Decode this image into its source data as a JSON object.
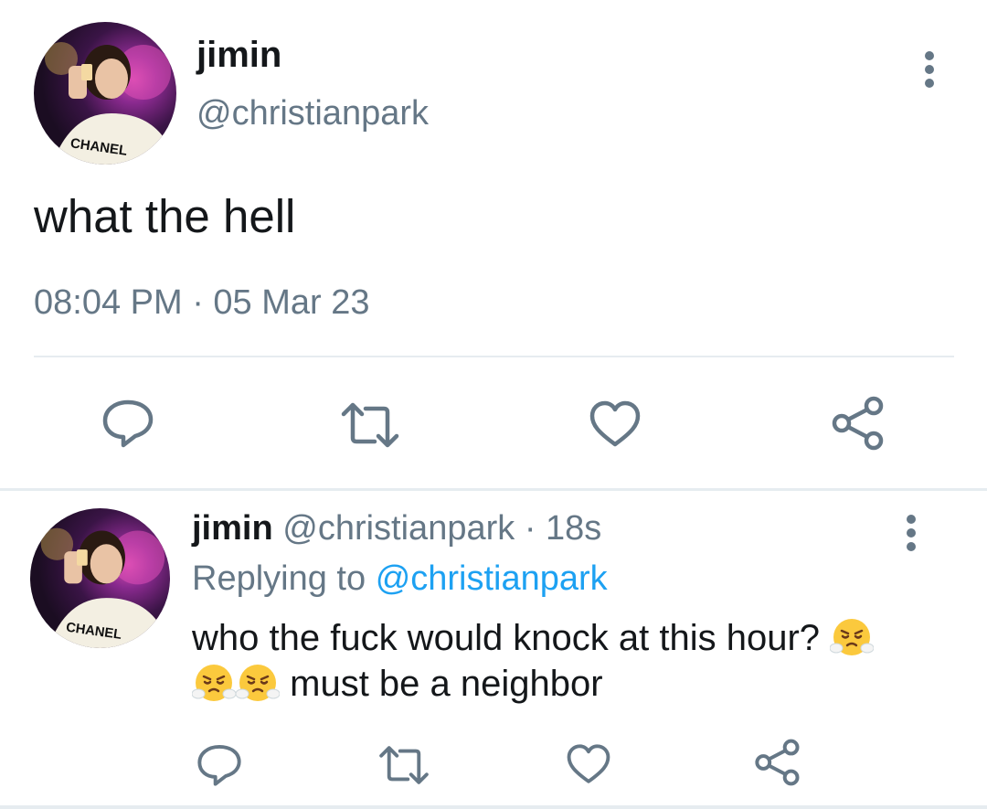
{
  "main_tweet": {
    "display_name": "jimin",
    "handle": "@christianpark",
    "avatar_text": "CHANEL",
    "text": "what the hell",
    "timestamp": "08:04 PM · 05 Mar 23"
  },
  "reply_tweet": {
    "display_name": "jimin",
    "handle": "@christianpark",
    "separator": "·",
    "time_ago": "18s",
    "replying_label": "Replying to",
    "replying_to": "@christianpark",
    "avatar_text": "CHANEL",
    "text_line1": "who the fuck would knock at this hour?",
    "text_line2": "must be a neighbor",
    "emoji_name": "face-with-steam-from-nose"
  },
  "colors": {
    "text": "#14171a",
    "secondary": "#657786",
    "link": "#1da1f2",
    "divider": "#e6ecf0"
  },
  "icons": [
    "more-vertical-icon",
    "reply-icon",
    "retweet-icon",
    "like-icon",
    "share-icon"
  ]
}
